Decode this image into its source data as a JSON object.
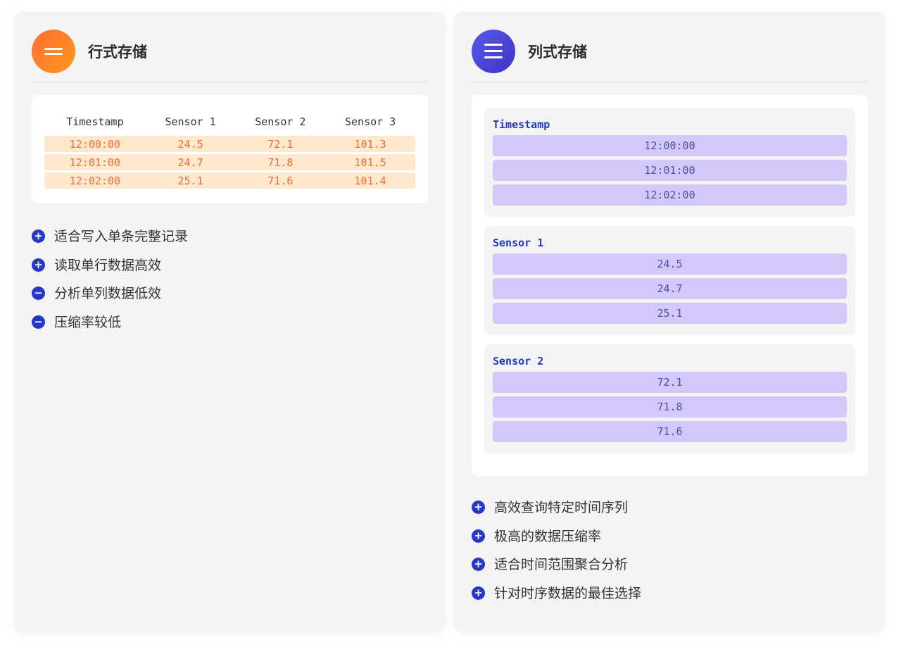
{
  "row_panel": {
    "title": "行式存储",
    "icon": "equals-icon",
    "accent": "#ff7a2a",
    "table": {
      "headers": [
        "Timestamp",
        "Sensor 1",
        "Sensor 2",
        "Sensor 3"
      ],
      "rows": [
        [
          "12:00:00",
          "24.5",
          "72.1",
          "101.3"
        ],
        [
          "12:01:00",
          "24.7",
          "71.8",
          "101.5"
        ],
        [
          "12:02:00",
          "25.1",
          "71.6",
          "101.4"
        ]
      ]
    },
    "features": [
      {
        "type": "plus",
        "symbol": "+",
        "text": "适合写入单条完整记录"
      },
      {
        "type": "plus",
        "symbol": "+",
        "text": "读取单行数据高效"
      },
      {
        "type": "minus",
        "symbol": "−",
        "text": "分析单列数据低效"
      },
      {
        "type": "minus",
        "symbol": "−",
        "text": "压缩率较低"
      }
    ]
  },
  "column_panel": {
    "title": "列式存储",
    "icon": "menu-icon",
    "accent": "#4a46d8",
    "columns": [
      {
        "name": "Timestamp",
        "values": [
          "12:00:00",
          "12:01:00",
          "12:02:00"
        ]
      },
      {
        "name": "Sensor 1",
        "values": [
          "24.5",
          "24.7",
          "25.1"
        ]
      },
      {
        "name": "Sensor 2",
        "values": [
          "72.1",
          "71.8",
          "71.6"
        ]
      }
    ],
    "features": [
      {
        "type": "plus",
        "symbol": "+",
        "text": "高效查询特定时间序列"
      },
      {
        "type": "plus",
        "symbol": "+",
        "text": "极高的数据压缩率"
      },
      {
        "type": "plus",
        "symbol": "+",
        "text": "适合时间范围聚合分析"
      },
      {
        "type": "plus",
        "symbol": "+",
        "text": "针对时序数据的最佳选择"
      }
    ]
  }
}
